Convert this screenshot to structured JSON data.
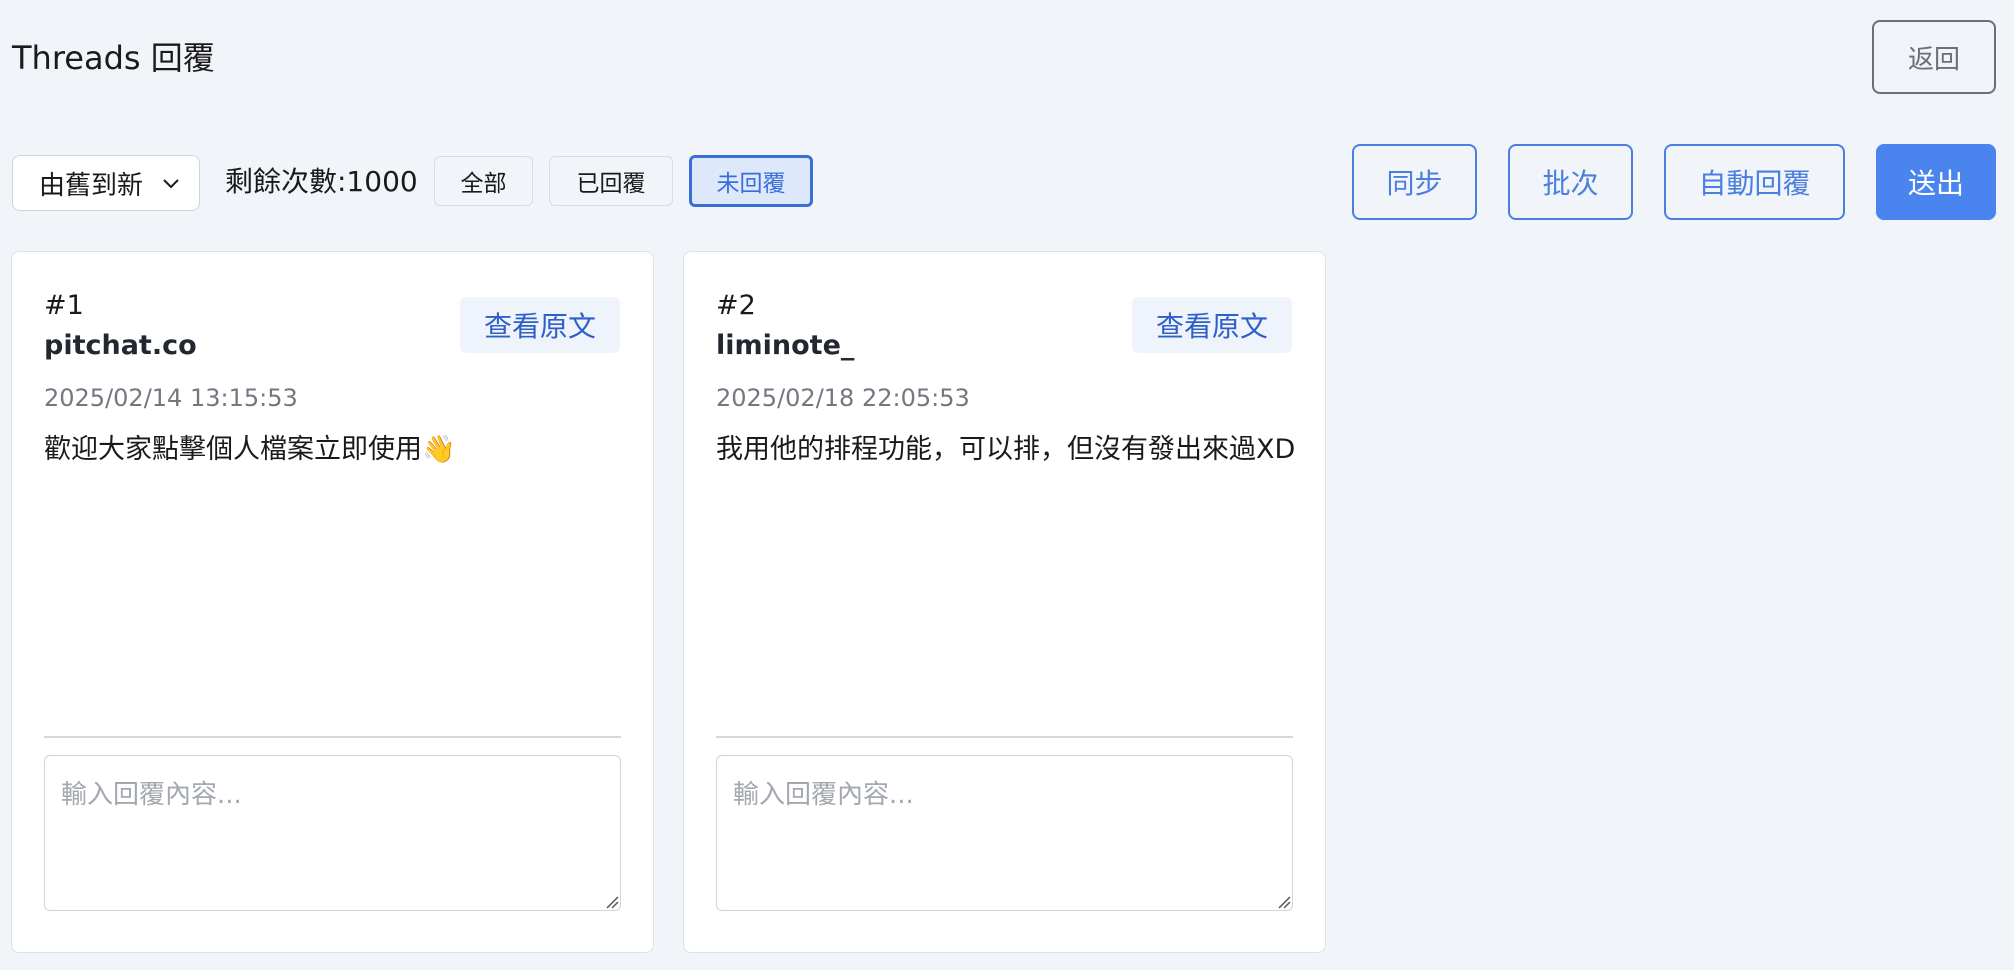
{
  "header": {
    "title": "Threads 回覆",
    "back_label": "返回"
  },
  "toolbar": {
    "sort_selected": "由舊到新",
    "remaining": "剩餘次數:1000",
    "filters": {
      "all": "全部",
      "replied": "已回覆",
      "unreplied": "未回覆",
      "active": "unreplied"
    },
    "actions": {
      "sync": "同步",
      "batch": "批次",
      "auto_reply": "自動回覆",
      "send": "送出"
    }
  },
  "cards": [
    {
      "number": "#1",
      "user": "pitchat.co",
      "view_label": "查看原文",
      "time": "2025/02/14 13:15:53",
      "text": "歡迎大家點擊個人檔案立即使用👋",
      "reply_placeholder": "輸入回覆內容..."
    },
    {
      "number": "#2",
      "user": "liminote_",
      "view_label": "查看原文",
      "time": "2025/02/18 22:05:53",
      "text": "我用他的排程功能，可以排，但沒有發出來過XD",
      "reply_placeholder": "輸入回覆內容..."
    }
  ],
  "colors": {
    "background": "#f1f4f9",
    "accent": "#4a84ee",
    "active_filter_border": "#3b6fd8"
  }
}
